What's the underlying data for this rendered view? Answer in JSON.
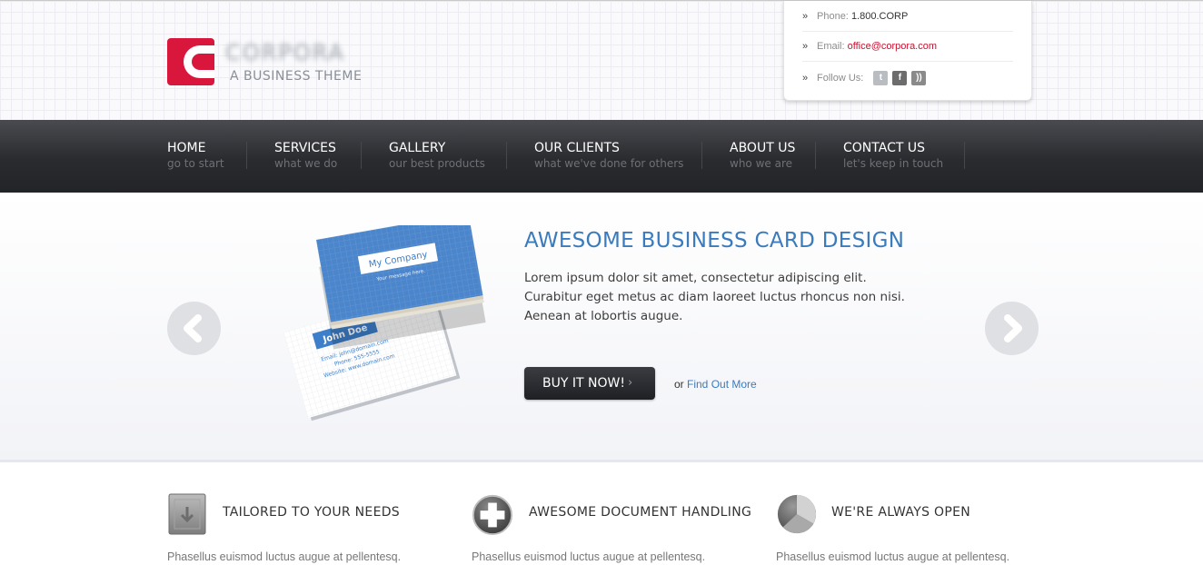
{
  "brand": {
    "name": "CORPORA",
    "tagline": "A BUSINESS THEME",
    "accent": "#d9173d"
  },
  "contact": {
    "phone_label": "Phone:",
    "phone_value": "1.800.CORP",
    "email_label": "Email:",
    "email_value": "office@corpora.com",
    "follow_label": "Follow Us:",
    "social": [
      "twitter-icon",
      "facebook-icon",
      "rss-icon"
    ]
  },
  "nav": {
    "items": [
      {
        "title": "HOME",
        "subtitle": "go to start"
      },
      {
        "title": "SERVICES",
        "subtitle": "what we do"
      },
      {
        "title": "GALLERY",
        "subtitle": "our best products"
      },
      {
        "title": "OUR CLIENTS",
        "subtitle": "what we've done for others"
      },
      {
        "title": "ABOUT US",
        "subtitle": "who we are"
      },
      {
        "title": "CONTACT US",
        "subtitle": "let's keep in touch"
      }
    ]
  },
  "hero": {
    "title": "AWESOME BUSINESS CARD DESIGN",
    "text": "Lorem ipsum dolor sit amet, consectetur adipiscing elit. Curabitur eget metus ac diam laoreet luctus rhoncus non nisi. Aenean at lobortis augue.",
    "button": "BUY IT NOW!",
    "or": "or",
    "link": "Find Out More",
    "card_front": {
      "company": "My Company",
      "message": "Your message here."
    },
    "card_back": {
      "name": "John Doe",
      "email": "Email: john@domain.com",
      "phone": "Phone: 555-5555",
      "website": "Website: www.domain.com"
    },
    "title_color": "#3a7bbd"
  },
  "features": [
    {
      "icon": "archive-box-icon",
      "title": "TAILORED TO YOUR NEEDS",
      "text": "Phasellus euismod luctus augue at pellentesq."
    },
    {
      "icon": "plus-circle-icon",
      "title": "AWESOME DOCUMENT HANDLING",
      "text": "Phasellus euismod luctus augue at pellentesq."
    },
    {
      "icon": "pie-chart-icon",
      "title": "WE'RE ALWAYS OPEN",
      "text": "Phasellus euismod luctus augue at pellentesq."
    }
  ]
}
